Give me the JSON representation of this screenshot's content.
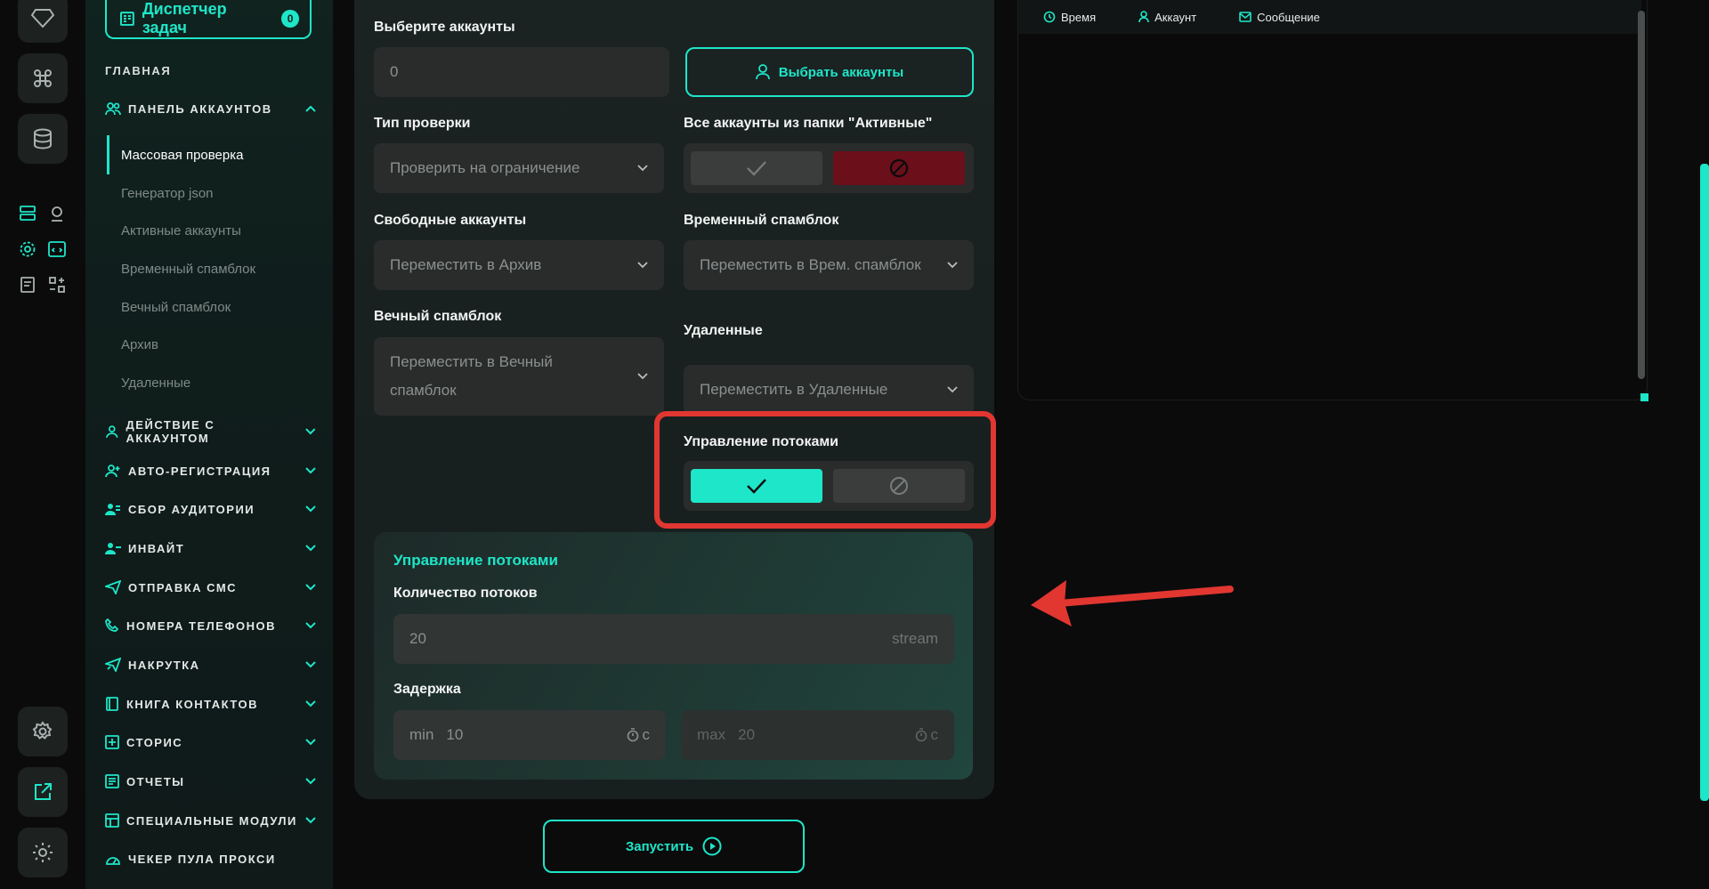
{
  "sidebar": {
    "task_manager": {
      "label": "Диспетчер задач",
      "count": "0"
    },
    "main_label": "ГЛАВНАЯ",
    "accounts_panel": "ПАНЕЛЬ АККАУНТОВ",
    "sub_items": [
      "Массовая проверка",
      "Генератор json",
      "Активные аккаунты",
      "Временный спамблок",
      "Вечный спамблок",
      "Архив",
      "Удаленные"
    ],
    "sections": [
      "ДЕЙСТВИЕ С АККАУНТОМ",
      "АВТО-РЕГИСТРАЦИЯ",
      "СБОР АУДИТОРИИ",
      "ИНВАЙТ",
      "ОТПРАВКА СМС",
      "НОМЕРА ТЕЛЕФОНОВ",
      "НАКРУТКА",
      "КНИГА КОНТАКТОВ",
      "СТОРИС",
      "ОТЧЕТЫ",
      "СПЕЦИАЛЬНЫЕ МОДУЛИ",
      "ЧЕКЕР ПУЛА ПРОКСИ"
    ]
  },
  "form": {
    "select_accounts_label": "Выберите аккаунты",
    "select_accounts_value": "0",
    "select_accounts_button": "Выбрать аккаунты",
    "check_type_label": "Тип проверки",
    "check_type_value": "Проверить на ограничение",
    "all_active_label": "Все аккаунты из папки \"Активные\"",
    "free_accounts_label": "Свободные аккаунты",
    "free_accounts_value": "Переместить в Архив",
    "temp_spamblock_label": "Временный спамблок",
    "temp_spamblock_value": "Переместить в Врем. спамблок",
    "eternal_spamblock_label": "Вечный спамблок",
    "eternal_spamblock_value_1": "Переместить в Вечный",
    "eternal_spamblock_value_2": "спамблок",
    "deleted_label": "Удаленные",
    "deleted_value": "Переместить в Удаленные",
    "thread_control_label": "Управление потоками",
    "threads_section_title": "Управление потоками",
    "threads_count_label": "Количество потоков",
    "threads_count_value": "20",
    "threads_unit": "stream",
    "delay_label": "Задержка",
    "delay_min_prefix": "min",
    "delay_min_value": "10",
    "delay_max_prefix": "max",
    "delay_max_value": "20",
    "delay_unit": "с",
    "run_button": "Запустить"
  },
  "log": {
    "columns": [
      "Время",
      "Аккаунт",
      "Сообщение"
    ]
  },
  "colors": {
    "accent": "#1ee6c8",
    "danger": "#6b0f1a",
    "highlight": "#e23631"
  }
}
